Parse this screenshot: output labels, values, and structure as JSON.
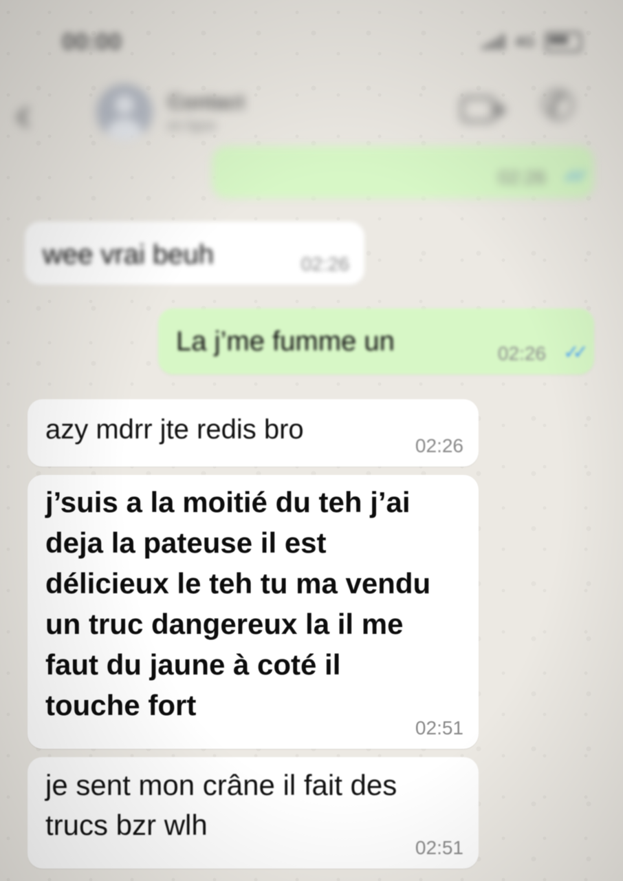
{
  "status_bar": {
    "time": "00:00"
  },
  "header": {
    "contact_name": "Contact",
    "contact_status": "en ligne"
  },
  "messages": [
    {
      "direction": "outgoing",
      "text": "",
      "time": "02:26",
      "read": true
    },
    {
      "direction": "incoming",
      "text": "wee vrai beuh",
      "time": "02:26"
    },
    {
      "direction": "outgoing",
      "text": "La j’me fumme un",
      "time": "02:26",
      "read": true
    },
    {
      "direction": "incoming",
      "text": "azy mdrr jte redis bro",
      "time": "02:26"
    },
    {
      "direction": "incoming",
      "text": "j’suis a la moitié du teh j’ai\ndeja la pateuse il est\ndélicieux le teh tu ma vendu\nun truc dangereux la il me\nfaut du jaune à coté il\ntouche fort",
      "time": "02:51"
    },
    {
      "direction": "incoming",
      "text": "je sent mon crâne il fait des\ntrucs bzr wlh",
      "time": "02:51"
    }
  ],
  "colors": {
    "incoming_bubble": "#ffffff",
    "outgoing_bubble": "#d7f7c6",
    "read_ticks": "#4ea4f6"
  },
  "icons": [
    "back-icon",
    "avatar",
    "video-call-icon",
    "phone-call-icon",
    "signal-icon",
    "battery-icon",
    "read-ticks-icon"
  ]
}
